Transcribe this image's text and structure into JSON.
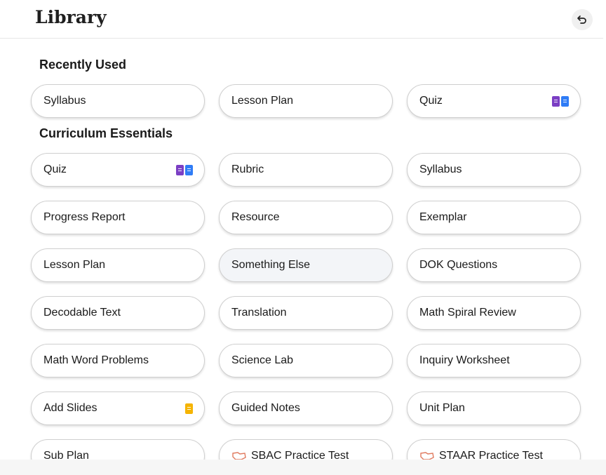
{
  "header": {
    "title": "Library"
  },
  "sections": [
    {
      "title": "Recently Used",
      "items": [
        {
          "label": "Syllabus",
          "icons": []
        },
        {
          "label": "Lesson Plan",
          "icons": []
        },
        {
          "label": "Quiz",
          "icons": [
            "forms",
            "docs"
          ]
        }
      ]
    },
    {
      "title": "Curriculum Essentials",
      "items": [
        {
          "label": "Quiz",
          "icons": [
            "forms",
            "docs"
          ]
        },
        {
          "label": "Rubric",
          "icons": []
        },
        {
          "label": "Syllabus",
          "icons": []
        },
        {
          "label": "Progress Report",
          "icons": []
        },
        {
          "label": "Resource",
          "icons": []
        },
        {
          "label": "Exemplar",
          "icons": []
        },
        {
          "label": "Lesson Plan",
          "icons": []
        },
        {
          "label": "Something Else",
          "icons": [],
          "hover": true
        },
        {
          "label": "DOK Questions",
          "icons": []
        },
        {
          "label": "Decodable Text",
          "icons": []
        },
        {
          "label": "Translation",
          "icons": []
        },
        {
          "label": "Math Spiral Review",
          "icons": []
        },
        {
          "label": "Math Word Problems",
          "icons": []
        },
        {
          "label": "Science Lab",
          "icons": []
        },
        {
          "label": "Inquiry Worksheet",
          "icons": []
        },
        {
          "label": "Add Slides",
          "icons": [
            "slides"
          ]
        },
        {
          "label": "Guided Notes",
          "icons": []
        },
        {
          "label": "Unit Plan",
          "icons": []
        },
        {
          "label": "Sub Plan",
          "icons": []
        },
        {
          "label": "SBAC Practice Test",
          "icons": [],
          "pre_icon": "state-outline-icon"
        },
        {
          "label": "STAAR Practice Test",
          "icons": [],
          "pre_icon": "state-outline-icon"
        }
      ]
    }
  ],
  "icon_names": {
    "forms": "google-forms-icon",
    "docs": "google-docs-icon",
    "slides": "google-slides-icon"
  },
  "colors": {
    "forms": "#7b3fc4",
    "docs": "#2f7cf6",
    "slides": "#f5b400",
    "state_outline": "#e07a5f"
  }
}
